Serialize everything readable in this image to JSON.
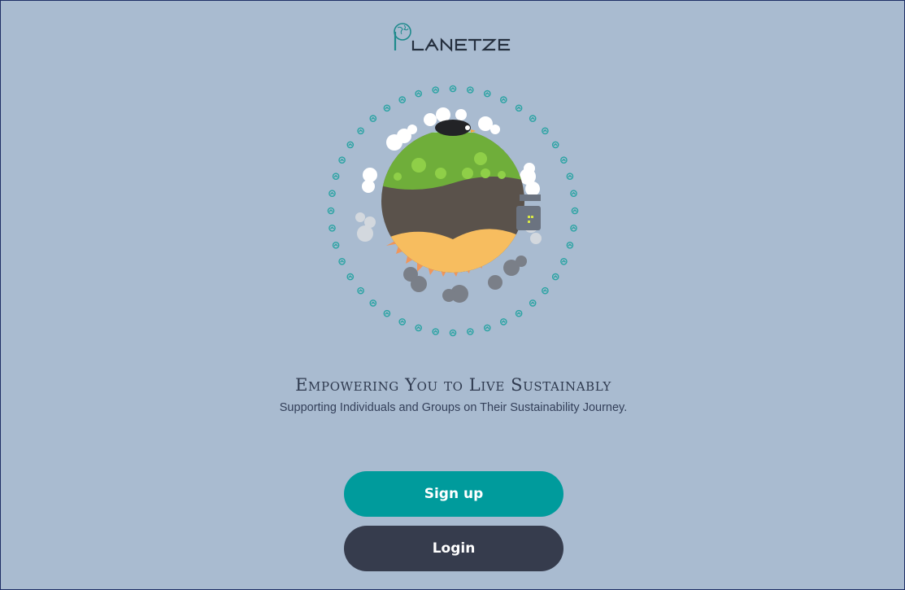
{
  "brand": {
    "name": "PLANETZE",
    "logo_color": "#1e8a8c"
  },
  "hero": {
    "headline": "Empowering You to Live Sustainably",
    "subheadline": "Supporting Individuals and Groups on Their Sustainability Journey."
  },
  "actions": {
    "signup_label": "Sign up",
    "login_label": "Login"
  },
  "colors": {
    "background": "#a9bbd0",
    "primary": "#009b9c",
    "secondary": "#363c4d",
    "text": "#2f3a4f"
  }
}
